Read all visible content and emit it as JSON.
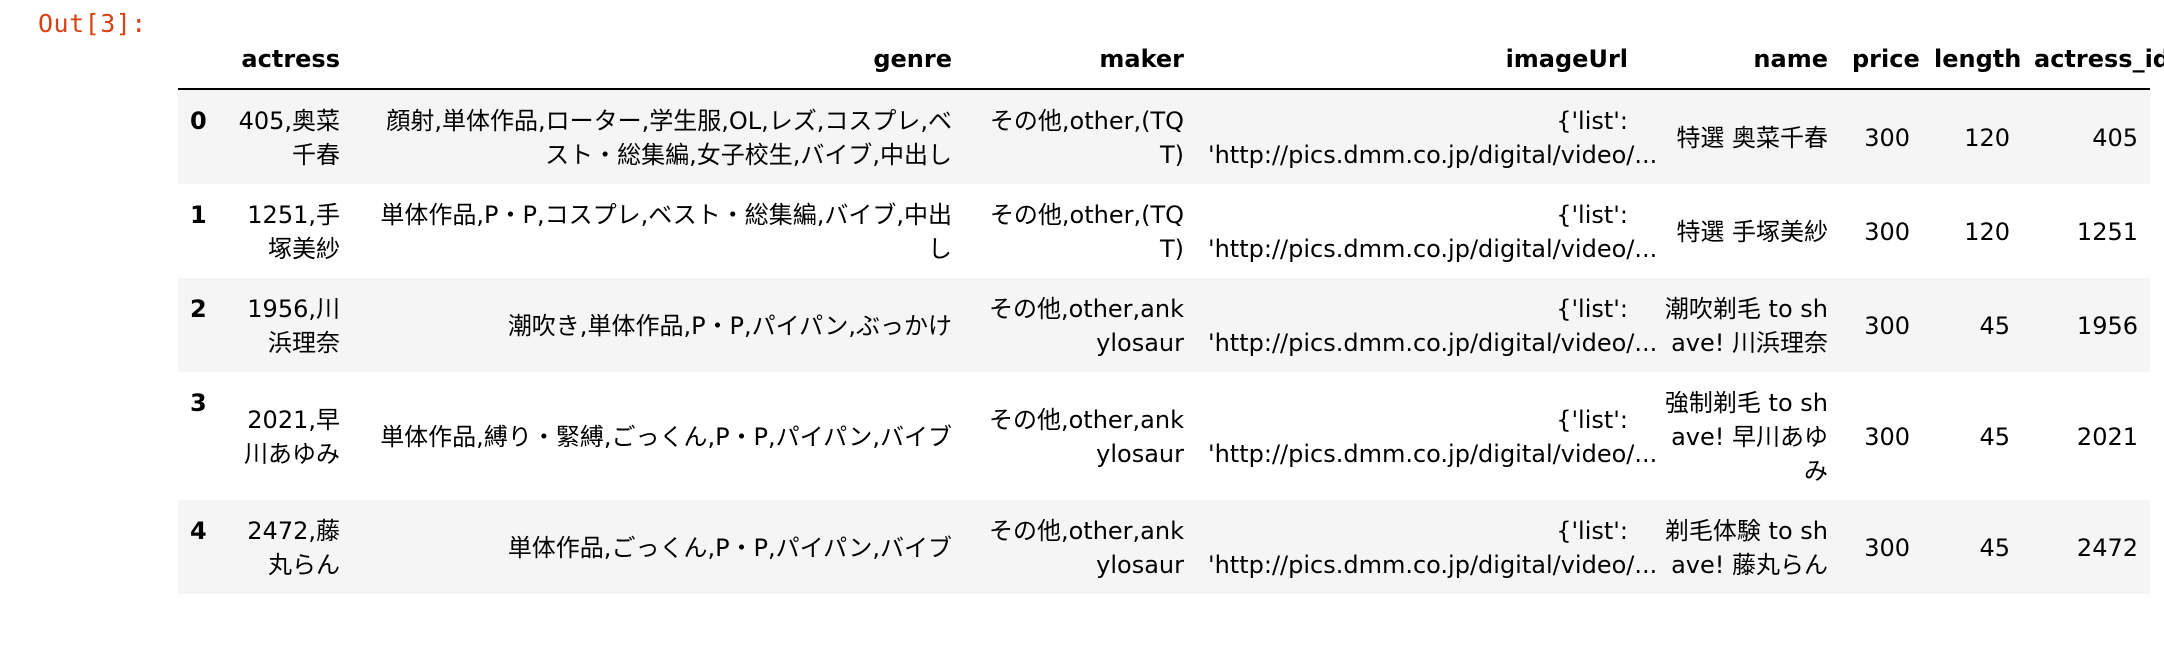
{
  "prompt": {
    "label": "Out[3]:"
  },
  "table": {
    "columns": [
      "actress",
      "genre",
      "maker",
      "imageUrl",
      "name",
      "price",
      "length",
      "actress_id"
    ],
    "rows": [
      {
        "index": "0",
        "actress": "405,奥菜千春",
        "genre": "顔射,単体作品,ローター,学生服,OL,レズ,コスプレ,ベスト・総集編,女子校生,バイブ,中出し",
        "maker": "その他,other,(TQT)",
        "imageUrl_1": "{'list':",
        "imageUrl_2": "'http://pics.dmm.co.jp/digital/video/...",
        "name": "特選 奥菜千春",
        "price": "300",
        "length": "120",
        "actress_id": "405"
      },
      {
        "index": "1",
        "actress": "1251,手塚美紗",
        "genre": "単体作品,P・P,コスプレ,ベスト・総集編,バイブ,中出し",
        "maker": "その他,other,(TQT)",
        "imageUrl_1": "{'list':",
        "imageUrl_2": "'http://pics.dmm.co.jp/digital/video/...",
        "name": "特選 手塚美紗",
        "price": "300",
        "length": "120",
        "actress_id": "1251"
      },
      {
        "index": "2",
        "actress": "1956,川浜理奈",
        "genre": "潮吹き,単体作品,P・P,パイパン,ぶっかけ",
        "maker": "その他,other,ankylosaur",
        "imageUrl_1": "{'list':",
        "imageUrl_2": "'http://pics.dmm.co.jp/digital/video/...",
        "name": "潮吹剃毛 to shave! 川浜理奈",
        "price": "300",
        "length": "45",
        "actress_id": "1956"
      },
      {
        "index": "3",
        "actress": "2021,早川あゆみ",
        "genre": "単体作品,縛り・緊縛,ごっくん,P・P,パイパン,バイブ",
        "maker": "その他,other,ankylosaur",
        "imageUrl_1": "{'list':",
        "imageUrl_2": "'http://pics.dmm.co.jp/digital/video/...",
        "name": "強制剃毛 to shave! 早川あゆみ",
        "price": "300",
        "length": "45",
        "actress_id": "2021"
      },
      {
        "index": "4",
        "actress": "2472,藤丸らん",
        "genre": "単体作品,ごっくん,P・P,パイパン,バイブ",
        "maker": "その他,other,ankylosaur",
        "imageUrl_1": "{'list':",
        "imageUrl_2": "'http://pics.dmm.co.jp/digital/video/...",
        "name": "剃毛体験 to shave! 藤丸らん",
        "price": "300",
        "length": "45",
        "actress_id": "2472"
      }
    ]
  },
  "colors": {
    "prompt": "#d84315",
    "stripe": "#f5f5f5"
  }
}
